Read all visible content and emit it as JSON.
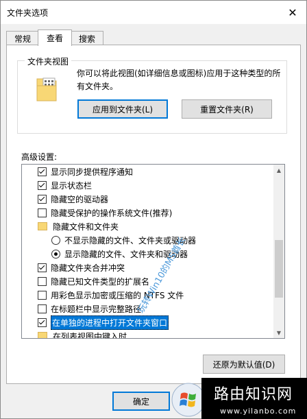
{
  "window": {
    "title": "文件夹选项"
  },
  "tabs": [
    {
      "label": "常规"
    },
    {
      "label": "查看"
    },
    {
      "label": "搜索"
    }
  ],
  "folder_views": {
    "group_title": "文件夹视图",
    "description": "你可以将此视图(如详细信息或图标)应用于这种类型的所有文件夹。",
    "apply_button": "应用到文件夹(L)",
    "reset_button": "重置文件夹(R)"
  },
  "advanced": {
    "label": "高级设置:",
    "items": [
      {
        "type": "checkbox",
        "checked": true,
        "label": "显示同步提供程序通知"
      },
      {
        "type": "checkbox",
        "checked": true,
        "label": "显示状态栏"
      },
      {
        "type": "checkbox",
        "checked": true,
        "label": "隐藏空的驱动器"
      },
      {
        "type": "checkbox",
        "checked": false,
        "label": "隐藏受保护的操作系统文件(推荐)"
      },
      {
        "type": "folder",
        "label": "隐藏文件和文件夹"
      },
      {
        "type": "radio",
        "checked": false,
        "label": "不显示隐藏的文件、文件夹或驱动器"
      },
      {
        "type": "radio",
        "checked": true,
        "label": "显示隐藏的文件、文件夹和驱动器"
      },
      {
        "type": "checkbox",
        "checked": true,
        "label": "隐藏文件夹合并冲突"
      },
      {
        "type": "checkbox",
        "checked": false,
        "label": "隐藏已知文件类型的扩展名"
      },
      {
        "type": "checkbox",
        "checked": false,
        "label": "用彩色显示加密或压缩的 NTFS 文件"
      },
      {
        "type": "checkbox",
        "checked": false,
        "label": "在标题栏中显示完整路径"
      },
      {
        "type": "checkbox",
        "checked": true,
        "label": "在单独的进程中打开文件夹窗口",
        "selected": true
      },
      {
        "type": "folder",
        "label": "在列表视图中键入时"
      }
    ],
    "restore_button": "还原为默认值(D)"
  },
  "footer": {
    "ok_button": "确定"
  },
  "watermark": "玩转Win10的MS酋长",
  "site_logo": {
    "title": "路由知识网",
    "url": "www.yilanbo.com"
  }
}
